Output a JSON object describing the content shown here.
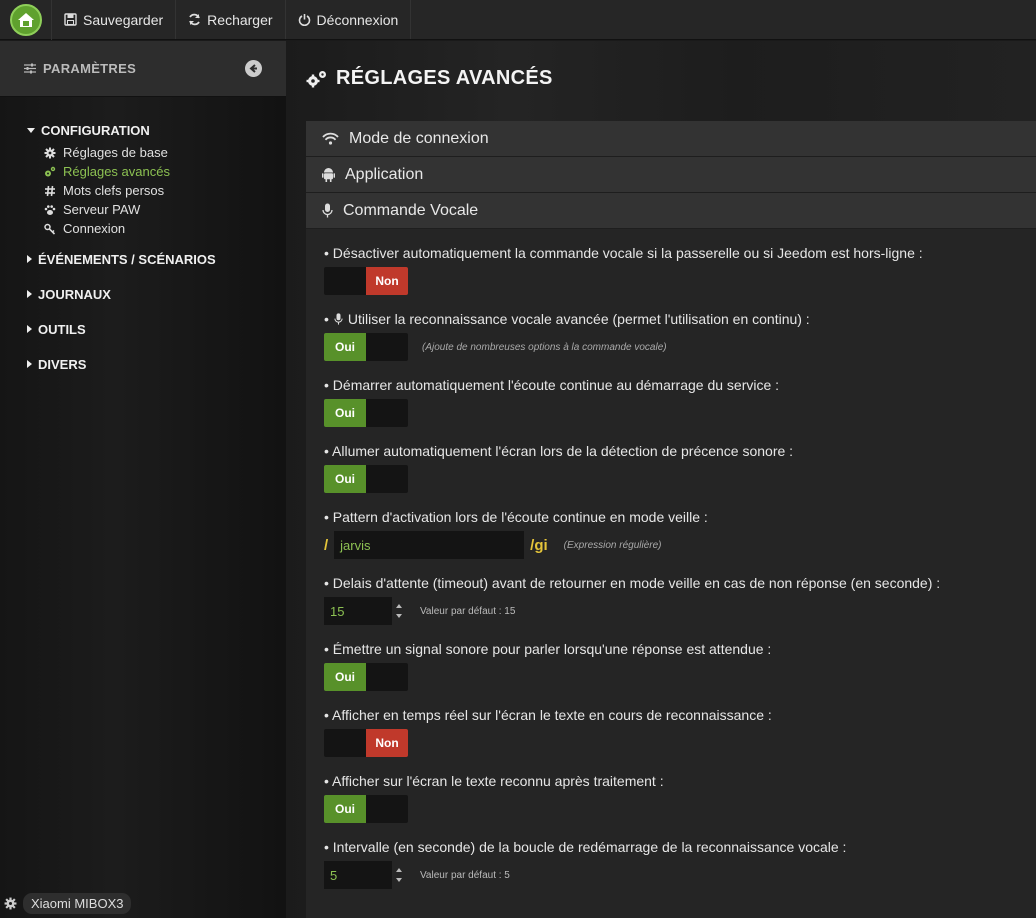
{
  "topbar": {
    "save_label": "Sauvegarder",
    "reload_label": "Recharger",
    "logout_label": "Déconnexion"
  },
  "sidebar": {
    "title": "PARAMÈTRES",
    "groups": [
      {
        "label": "CONFIGURATION",
        "expanded": true,
        "items": [
          {
            "label": "Réglages de base",
            "icon": "gear-icon"
          },
          {
            "label": "Réglages avancés",
            "icon": "gears-icon",
            "active": true
          },
          {
            "label": "Mots clefs persos",
            "icon": "hashtag-icon"
          },
          {
            "label": "Serveur PAW",
            "icon": "paw-icon"
          },
          {
            "label": "Connexion",
            "icon": "key-icon"
          }
        ]
      },
      {
        "label": "ÉVÉNEMENTS / SCÉNARIOS",
        "expanded": false
      },
      {
        "label": "JOURNAUX",
        "expanded": false
      },
      {
        "label": "OUTILS",
        "expanded": false
      },
      {
        "label": "DIVERS",
        "expanded": false
      }
    ],
    "device": "Xiaomi MIBOX3"
  },
  "main": {
    "title": "RÉGLAGES AVANCÉS",
    "sections": [
      {
        "label": "Mode de connexion",
        "icon": "wifi-icon"
      },
      {
        "label": "Application",
        "icon": "android-icon"
      },
      {
        "label": "Commande Vocale",
        "icon": "microphone-icon"
      }
    ],
    "options": [
      {
        "label": "• Désactiver automatiquement la commande vocale si la passerelle ou si Jeedom est hors-ligne :",
        "state": "Non"
      },
      {
        "label": "Utiliser la reconnaissance vocale avancée (permet l'utilisation en continu) :",
        "state": "Oui",
        "hint": "(Ajoute de nombreuses options à la commande vocale)"
      },
      {
        "label": "• Démarrer automatiquement l'écoute continue au démarrage du service :",
        "state": "Oui"
      },
      {
        "label": "•  Allumer automatiquement l'écran lors de la détection de précence sonore :",
        "state": "Oui"
      },
      {
        "label": "• Pattern d'activation lors de l'écoute continue en mode veille :",
        "prefix": "/",
        "value": "jarvis",
        "suffix": "/gi",
        "hint": "(Expression régulière)"
      },
      {
        "label": "• Delais d'attente (timeout) avant de retourner en mode veille en cas de non réponse (en seconde) :",
        "value": "15",
        "hint": "Valeur par défaut : 15"
      },
      {
        "label": "• Émettre un signal sonore pour parler lorsqu'une réponse est attendue :",
        "state": "Oui"
      },
      {
        "label": "• Afficher en temps réel sur l'écran le texte en cours de reconnaissance :",
        "state": "Non"
      },
      {
        "label": "• Afficher sur l'écran le texte reconnu après traitement :",
        "state": "Oui"
      },
      {
        "label": "• Intervalle (en seconde) de la boucle de redémarrage de la reconnaissance vocale :",
        "value": "5",
        "hint": "Valeur par défaut : 5"
      }
    ]
  },
  "colors": {
    "accent_green": "#8cc152",
    "toggle_on": "#58912a",
    "toggle_off": "#c0392b",
    "pattern_slash": "#e5c53a"
  }
}
